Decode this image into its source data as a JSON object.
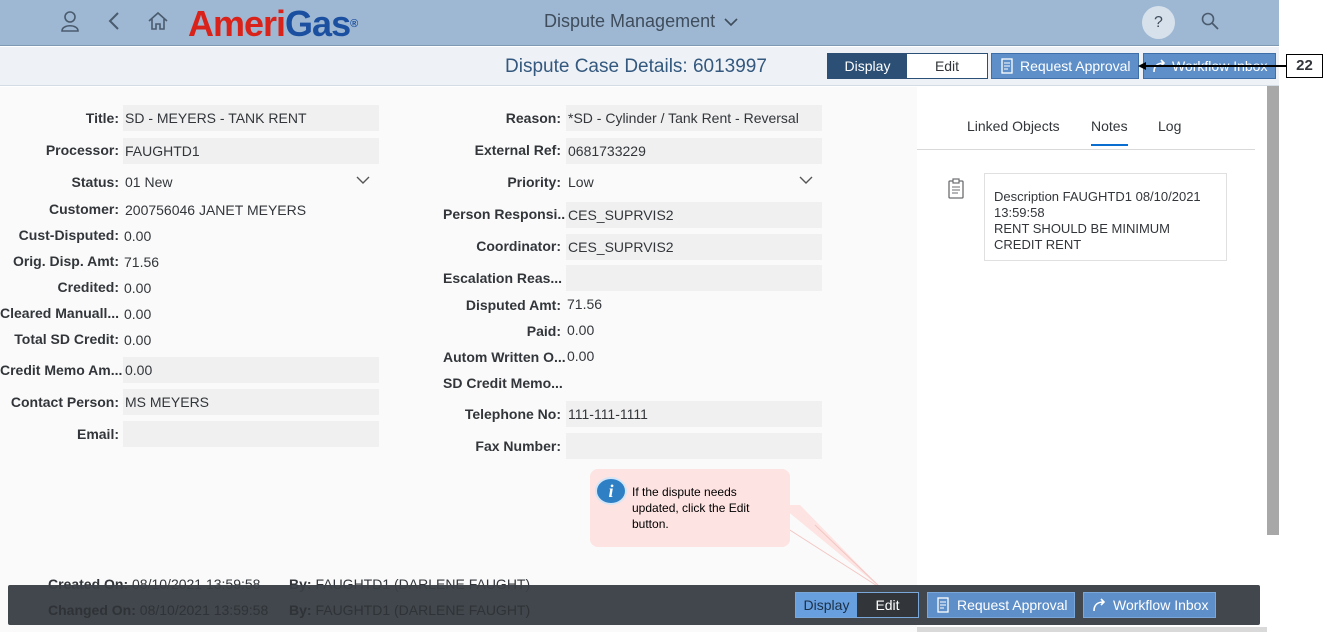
{
  "shell": {
    "logo_part1": "A",
    "logo_part2": "meri",
    "logo_part3": "Gas",
    "logo_reg": "®",
    "app_title": "Dispute Management",
    "help_label": "?"
  },
  "header": {
    "page_title": "Dispute Case Details: 6013997",
    "display_label": "Display",
    "edit_label": "Edit",
    "request_approval_label": "Request Approval",
    "workflow_inbox_label": "Workflow Inbox"
  },
  "callout": {
    "number": "22"
  },
  "form": {
    "left": [
      {
        "label": "Title:",
        "value": "SD - MEYERS - TANK RENT"
      },
      {
        "label": "Processor:",
        "value": "FAUGHTD1"
      },
      {
        "label": "Status:",
        "value": "01 New"
      },
      {
        "label": "Customer:",
        "value": "200756046 JANET MEYERS"
      },
      {
        "label": "Cust-Disputed:",
        "value": "0.00"
      },
      {
        "label": "Orig. Disp. Amt:",
        "value": "71.56"
      },
      {
        "label": "Credited:",
        "value": "0.00"
      },
      {
        "label": "Cleared Manuall...",
        "value": "0.00"
      },
      {
        "label": "Total SD Credit:",
        "value": "0.00"
      },
      {
        "label": "Credit Memo Am...",
        "value": "0.00"
      },
      {
        "label": "Contact Person:",
        "value": "MS MEYERS"
      },
      {
        "label": "Email:",
        "value": ""
      }
    ],
    "right": [
      {
        "label": "Reason:",
        "value": "*SD - Cylinder / Tank Rent - Reversal"
      },
      {
        "label": "External Ref:",
        "value": "0681733229"
      },
      {
        "label": "Priority:",
        "value": "Low"
      },
      {
        "label": "Person Responsi...",
        "value": "CES_SUPRVIS2"
      },
      {
        "label": "Coordinator:",
        "value": "CES_SUPRVIS2"
      },
      {
        "label": "Escalation Reas...",
        "value": ""
      },
      {
        "label": "Disputed Amt:",
        "value": "71.56"
      },
      {
        "label": "Paid:",
        "value": "0.00"
      },
      {
        "label": "Autom Written O...",
        "value": "0.00"
      },
      {
        "label": "SD Credit Memo...",
        "value": ""
      },
      {
        "label": "Telephone No:",
        "value": "111-111-1111"
      },
      {
        "label": "Fax Number:",
        "value": ""
      }
    ],
    "created_on_label": "Created On:",
    "created_on_value": "08/10/2021 13:59:58",
    "created_by_label": "By:",
    "created_by_value": "FAUGHTD1 (DARLENE FAUGHT)",
    "changed_on_label": "Changed On:",
    "changed_on_value": "08/10/2021 13:59:58",
    "changed_by_label": "By:",
    "changed_by_value": "FAUGHTD1 (DARLENE FAUGHT)"
  },
  "side_panel": {
    "tabs": [
      "Linked Objects",
      "Notes",
      "Log"
    ],
    "active_tab": "Notes",
    "note_line1": "Description FAUGHTD1 08/10/2021",
    "note_line2": "13:59:58",
    "note_line3": "RENT SHOULD BE MINIMUM",
    "note_line4": "CREDIT RENT"
  },
  "tooltip": {
    "text_line1": "If the dispute needs",
    "text_line2": "updated, click the Edit",
    "text_line3": "button."
  },
  "footer": {
    "display_label": "Display",
    "edit_label": "Edit",
    "request_approval_label": "Request Approval",
    "workflow_inbox_label": "Workflow Inbox"
  },
  "colors": {
    "shell_bg": "#9eb8d3",
    "accent_dark": "#2b4f75",
    "button_blue": "#5e8fc8",
    "tooltip_bg": "#fde3e1",
    "footer_bg": "#3a3f46"
  },
  "icons": [
    "user-icon",
    "back-icon",
    "home-icon",
    "chevron-down-icon",
    "help-icon",
    "search-icon",
    "clipboard-icon",
    "forward-arrow-icon",
    "info-icon",
    "note-icon"
  ]
}
